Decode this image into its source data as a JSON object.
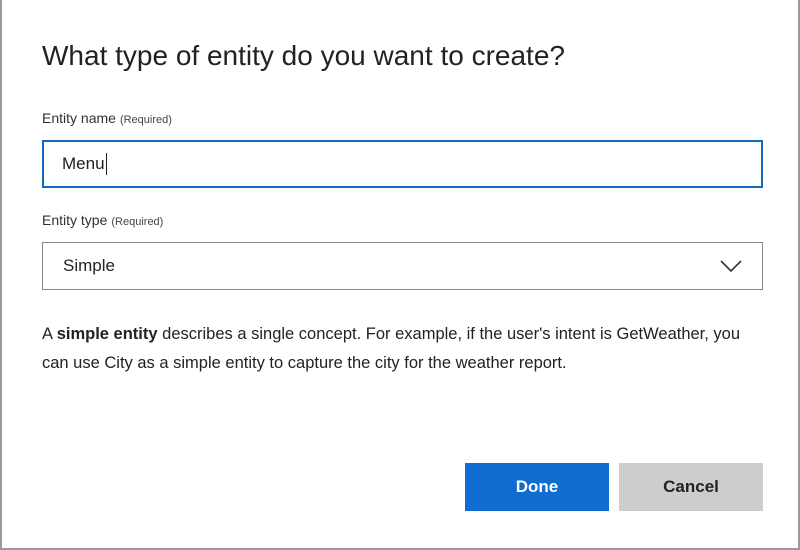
{
  "dialog": {
    "title": "What type of entity do you want to create?",
    "name_field": {
      "label": "Entity name",
      "required_text": "(Required)",
      "value": "Menu"
    },
    "type_field": {
      "label": "Entity type",
      "required_text": "(Required)",
      "selected": "Simple",
      "icon": "chevron-down-icon"
    },
    "description": {
      "prefix": "A ",
      "bold": "simple entity",
      "suffix": " describes a single concept. For example, if the user's intent is GetWeather, you can use City as a simple entity to capture the city for the weather report."
    },
    "buttons": {
      "done_label": "Done",
      "cancel_label": "Cancel"
    }
  },
  "colors": {
    "primary": "#0f6cd0",
    "focus_border": "#0f6cbd",
    "secondary_button": "#cdcdcd",
    "border": "#8a8886"
  }
}
